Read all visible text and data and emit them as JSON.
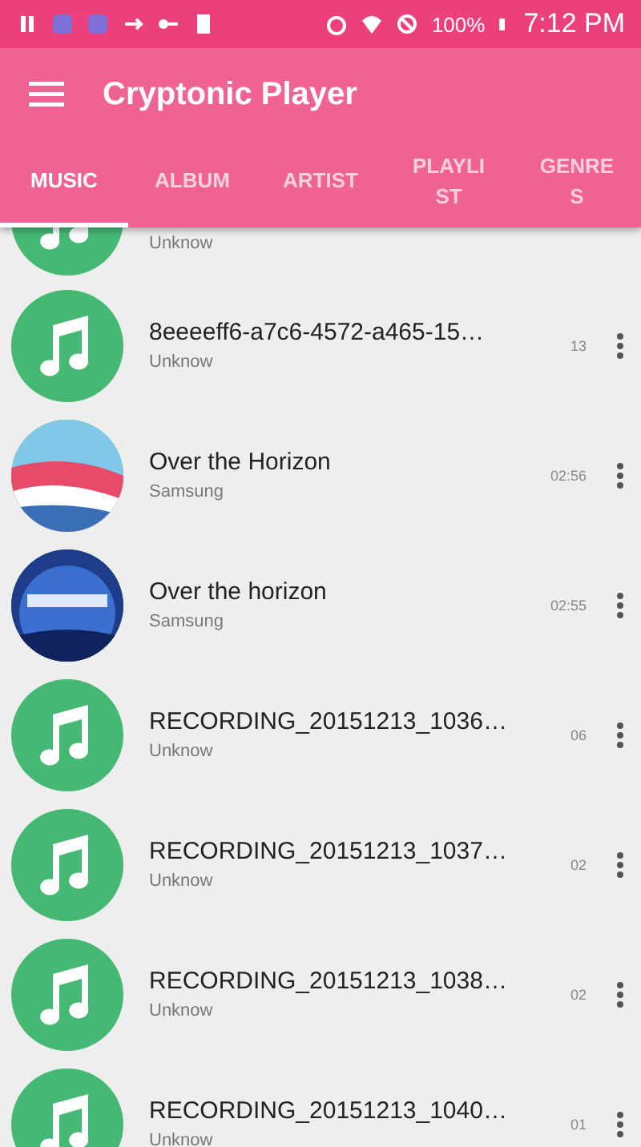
{
  "status_bar": {
    "battery": "100%",
    "time": "7:12 PM"
  },
  "toolbar": {
    "title": "Cryptonic Player"
  },
  "tabs": [
    {
      "label": "MUSIC",
      "selected": true
    },
    {
      "label": "ALBUM",
      "selected": false
    },
    {
      "label": "ARTIST",
      "selected": false
    },
    {
      "label": "PLAYLIST",
      "selected": false
    },
    {
      "label": "GENRES",
      "selected": false
    }
  ],
  "songs": [
    {
      "kind": "note",
      "subtitle": "Unknow"
    },
    {
      "kind": "note",
      "title": "8eeeeff6-a7c6-4572-a465-15…",
      "subtitle": "Unknow",
      "duration": "13"
    },
    {
      "kind": "picture",
      "title": "Over the Horizon",
      "subtitle": "Samsung",
      "duration": "02:56"
    },
    {
      "kind": "picture",
      "title": "Over the horizon",
      "subtitle": "Samsung",
      "duration": "02:55"
    },
    {
      "kind": "note",
      "title": "RECORDING_20151213_1036…",
      "subtitle": "Unknow",
      "duration": "06"
    },
    {
      "kind": "note",
      "title": "RECORDING_20151213_1037…",
      "subtitle": "Unknow",
      "duration": "02"
    },
    {
      "kind": "note",
      "title": "RECORDING_20151213_1038…",
      "subtitle": "Unknow",
      "duration": "02"
    },
    {
      "kind": "note",
      "title": "RECORDING_20151213_1040…",
      "subtitle": "Unknow",
      "duration": "01"
    }
  ]
}
